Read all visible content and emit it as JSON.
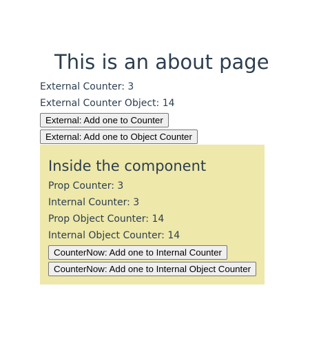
{
  "about": {
    "title": "This is an about page",
    "external_counter": "External Counter: 3",
    "external_counter_object": "External Counter Object: 14",
    "btn_add_counter": "External: Add one to Counter",
    "btn_add_object_counter": "External: Add one to Object Counter"
  },
  "component": {
    "background": "#eee8aa",
    "title": "Inside the component",
    "prop_counter": "Prop Counter: 3",
    "internal_counter": "Internal Counter: 3",
    "prop_object_counter": "Prop Object Counter: 14",
    "internal_object_counter": "Internal Object Counter: 14",
    "btn_add_internal": "CounterNow: Add one to Internal Counter",
    "btn_add_internal_object": "CounterNow: Add one to Internal Object Counter"
  }
}
